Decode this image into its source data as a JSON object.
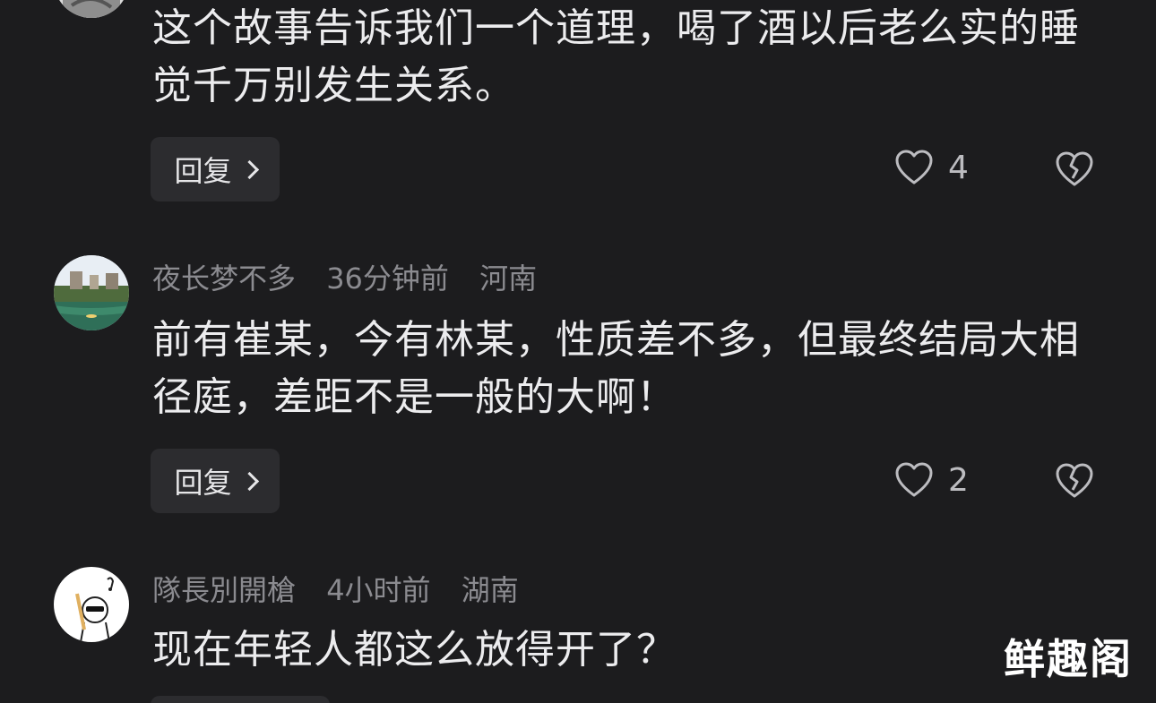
{
  "comments": [
    {
      "text": "这个故事告诉我们一个道理，喝了酒以后老么实的睡觉千万别发生关系。",
      "reply_label": "回复",
      "likes": "4"
    },
    {
      "username": "夜长梦不多",
      "time": "36分钟前",
      "location": "河南",
      "text": "前有崔某，今有林某，性质差不多，但最终结局大相径庭，差距不是一般的大啊！",
      "reply_label": "回复",
      "likes": "2"
    },
    {
      "username": "隊長別開槍",
      "time": "4小时前",
      "location": "湖南",
      "text": "现在年轻人都这么放得开了？"
    }
  ],
  "watermark": "鲜趣阁",
  "icons": {
    "like": "heart-outline-icon",
    "dislike": "broken-heart-icon",
    "reply_arrow": "chevron-right-icon"
  },
  "colors": {
    "background": "#1c1c1e",
    "meta_text": "#8b8b90",
    "body_text": "#ececee",
    "button_bg": "#2c2c2f"
  }
}
